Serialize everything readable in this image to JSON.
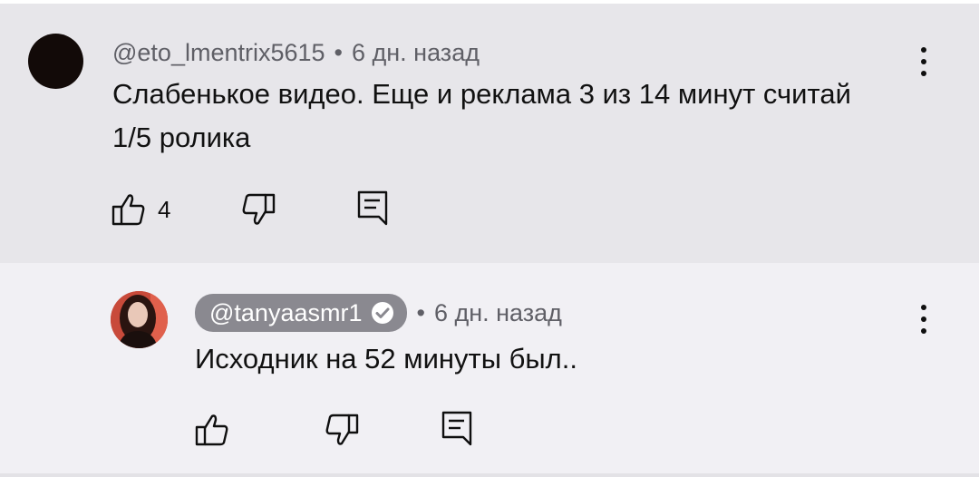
{
  "comment": {
    "author": "@eto_lmentrix5615",
    "separator": "•",
    "time": "6 дн. назад",
    "text_line1": "Слабенькое видео. Еще и реклама 3 из 14 минут  считай",
    "text_line2": "1/5 ролика",
    "like_count": "4",
    "icons": {
      "like": "thumbs-up-icon",
      "dislike": "thumbs-down-icon",
      "reply": "reply-icon",
      "menu": "more-vert-icon"
    }
  },
  "reply": {
    "author": "@tanyaasmr1",
    "verified": true,
    "separator": "•",
    "time": "6 дн. назад",
    "text": "Исходник на 52 минуты был..",
    "icons": {
      "like": "thumbs-up-icon",
      "dislike": "thumbs-down-icon",
      "reply": "reply-icon",
      "menu": "more-vert-icon",
      "verified": "verified-check-icon"
    }
  },
  "colors": {
    "main_background": "#e7e6ea",
    "reply_background": "#f1f0f4",
    "author_chip": "#8a8990",
    "meta_text": "#5f5f66"
  }
}
